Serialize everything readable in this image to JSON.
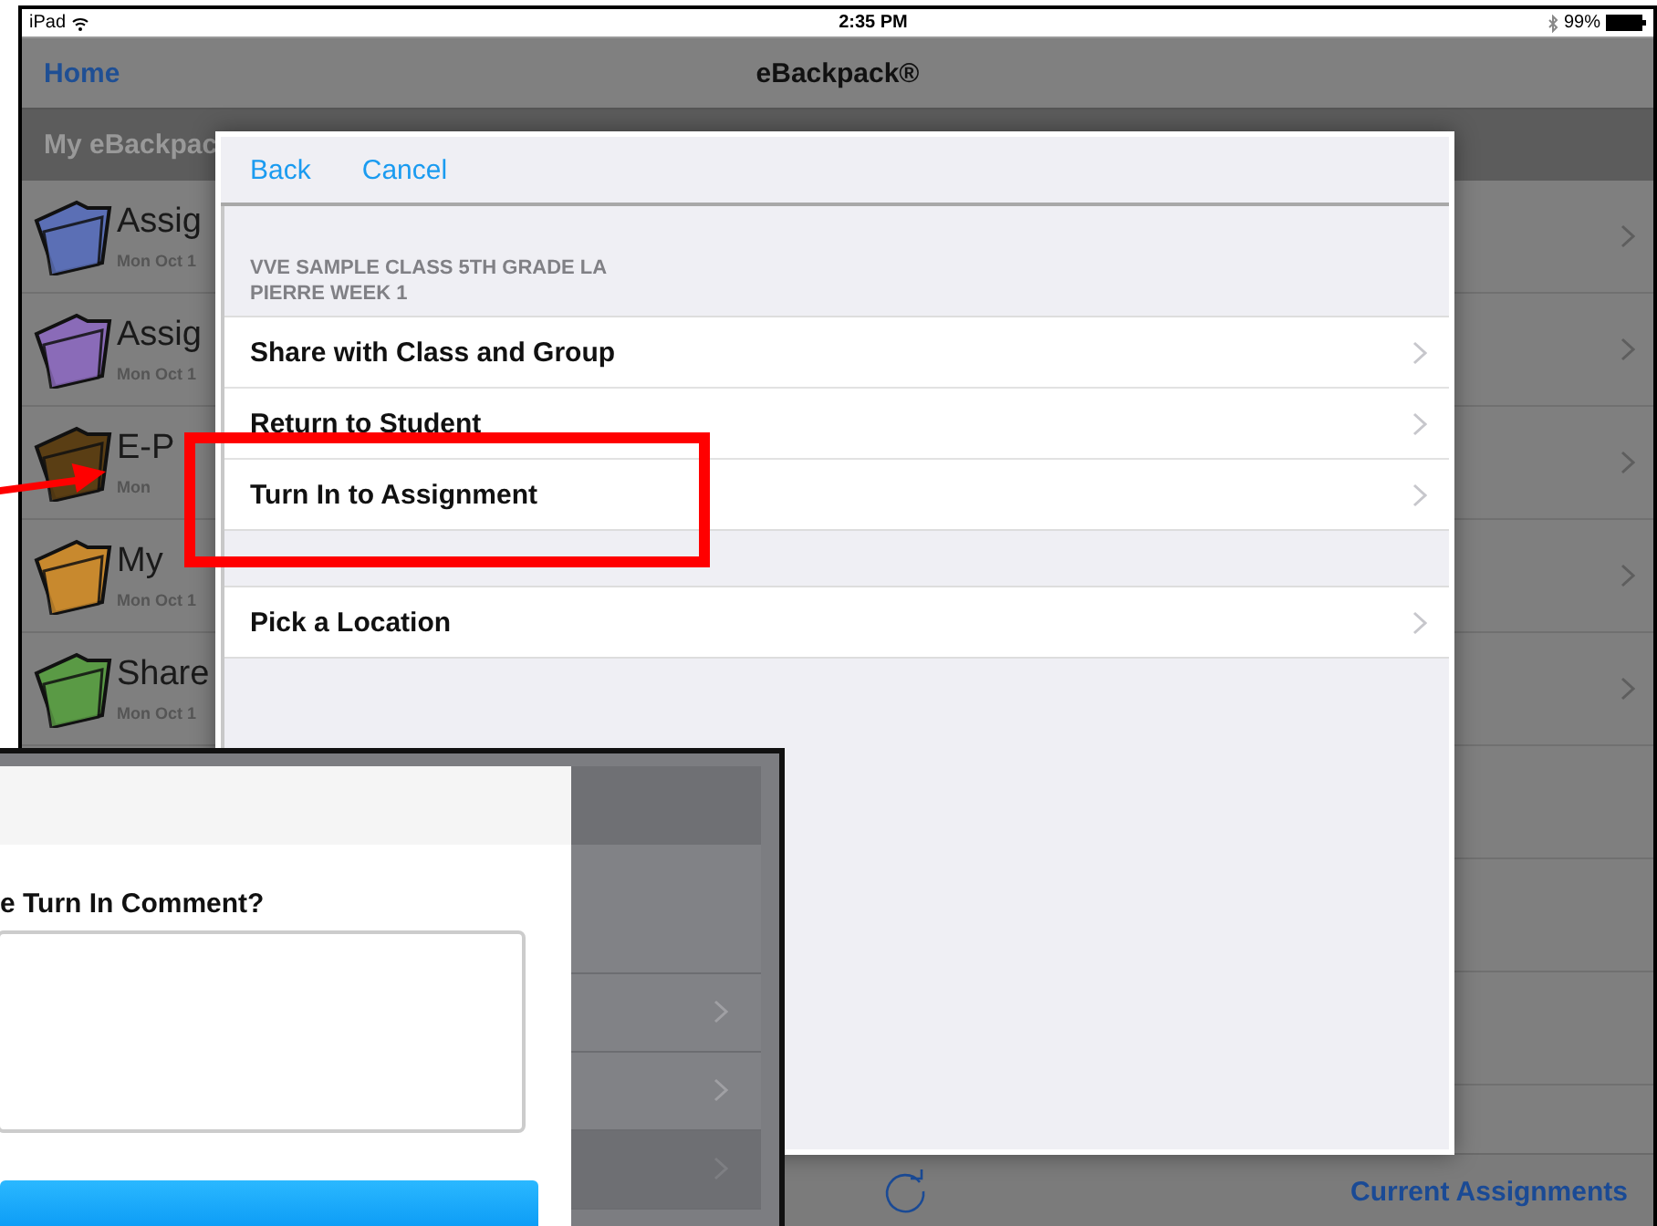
{
  "status_bar": {
    "device": "iPad",
    "time": "2:35 PM",
    "battery": "99%"
  },
  "nav_bar": {
    "back": "Home",
    "title": "eBackpack®"
  },
  "section_header": "My eBackpac",
  "folders": [
    {
      "title": "Assig",
      "date": "Mon Oct 1",
      "color": "#5b6fb5"
    },
    {
      "title": "Assig",
      "date": "Mon Oct 1",
      "color": "#8a6bb8"
    },
    {
      "title": "E-P",
      "date": "Mon",
      "color": "#5a3e14"
    },
    {
      "title": "My",
      "date": "Mon Oct 1",
      "color": "#c8892e"
    },
    {
      "title": "Share",
      "date": "Mon Oct 1",
      "color": "#5a9a45"
    }
  ],
  "toolbar": {
    "link": "Current Assignments"
  },
  "popover": {
    "buttons": [
      "Back",
      "Cancel"
    ],
    "groups": [
      {
        "header": "VVE SAMPLE CLASS 5TH GRADE LA PIERRE WEEK 1",
        "rows": [
          "Share with Class and Group",
          "Return to Student",
          "Turn In to Assignment"
        ]
      },
      {
        "rows": [
          "Pick a Location"
        ]
      }
    ]
  },
  "inset": {
    "prompt": "e Turn In Comment?"
  }
}
